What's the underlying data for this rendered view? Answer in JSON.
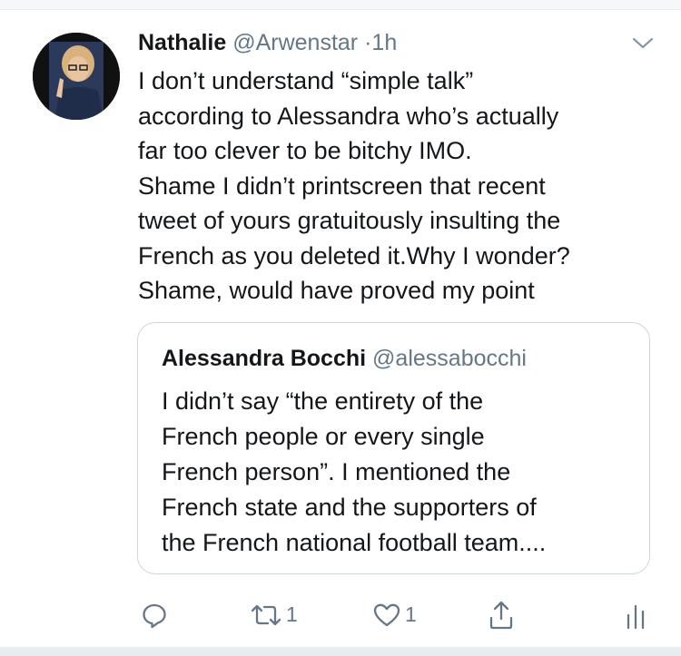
{
  "tweet": {
    "name": "Nathalie",
    "handle": "@Arwenstar",
    "separator": "·",
    "time": "1h",
    "text_lines": [
      "I don’t understand “simple talk”",
      "according to Alessandra who’s actually",
      "far too clever to be bitchy IMO.",
      "Shame I didn’t printscreen that recent",
      "tweet of yours gratuitously insulting the",
      "French as you deleted it.Why I wonder?",
      "Shame, would have proved my point"
    ]
  },
  "quoted_tweet": {
    "name": "Alessandra Bocchi",
    "handle": "@alessabocchi",
    "text_lines": [
      "I didn’t say “the entirety of the",
      "French people or every single",
      "French person”. I mentioned the",
      "French state and the supporters of",
      "the French national football team...."
    ]
  },
  "actions": {
    "reply_icon": "reply-icon",
    "retweet_icon": "retweet-icon",
    "retweet_count": "1",
    "like_icon": "heart-icon",
    "like_count": "1",
    "share_icon": "share-icon",
    "analytics_icon": "analytics-icon"
  },
  "colors": {
    "text": "#14171a",
    "secondary": "#657786",
    "border": "#ccd6dd"
  }
}
